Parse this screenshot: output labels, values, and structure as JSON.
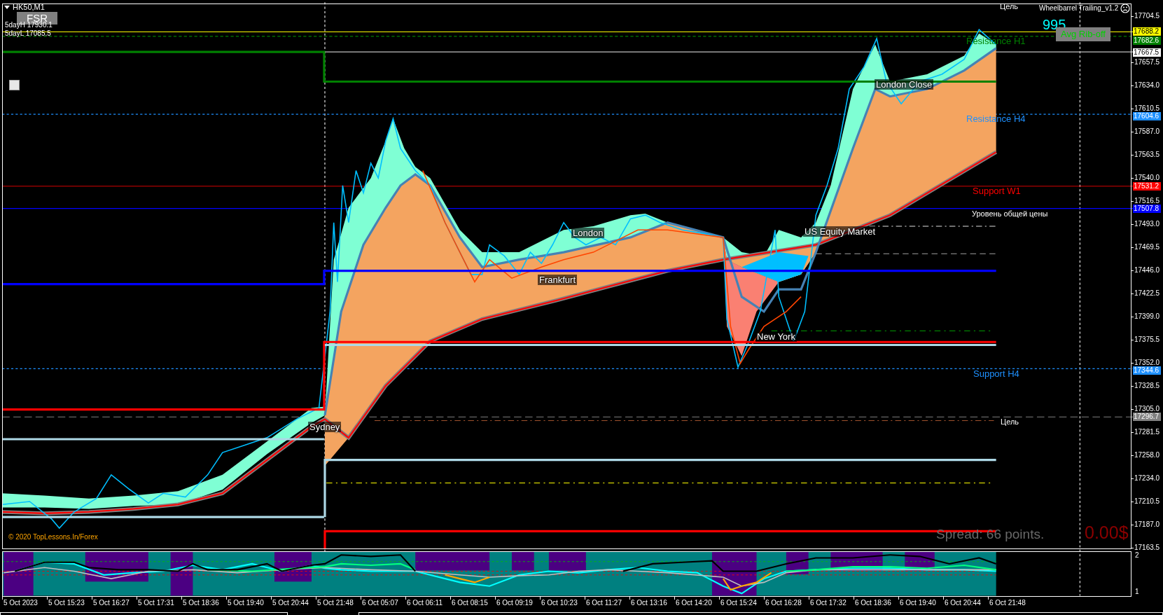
{
  "chart": {
    "symbol": "HK50,M1",
    "fsr_button": "FSR",
    "five_day_high": "5dayH 17930.1",
    "five_day_low": "5dayL 17085.5",
    "expert_name": "Wheelbarrel Trailing_v1.2",
    "counter": "995",
    "avg_button": "Avg Rib-off",
    "copyright": "© 2020 TopLessons.In/Forex",
    "spread": "Spread: 66 points.",
    "profit": "0.00$",
    "level_labels": [
      {
        "text": "Цель",
        "color": "#ffffff"
      },
      {
        "text": "Resistance H1",
        "color": "#008000"
      },
      {
        "text": "Resistance H4",
        "color": "#1e90ff"
      },
      {
        "text": "Support W1",
        "color": "#ff0000"
      },
      {
        "text": "Уровень общей цены",
        "color": "#ffffff"
      },
      {
        "text": "Support H4",
        "color": "#1e90ff"
      },
      {
        "text": "Цель",
        "color": "#ffffff"
      }
    ],
    "session_labels": [
      "Sydney",
      "London",
      "Frankfurt",
      "London Close",
      "US Equity Market",
      "New York"
    ]
  },
  "price_axis": {
    "ticks": [
      "17704.5",
      "17657.5",
      "17634.0",
      "17610.5",
      "17587.0",
      "17563.5",
      "17540.0",
      "17516.5",
      "17493.0",
      "17469.5",
      "17446.0",
      "17422.5",
      "17399.0",
      "17375.5",
      "17352.0",
      "17328.5",
      "17305.0",
      "17281.5",
      "17258.0",
      "17234.0",
      "17210.5",
      "17187.0",
      "17163.5"
    ],
    "markers": [
      {
        "text": "17688.2",
        "color": "#ffff00"
      },
      {
        "text": "17682.6",
        "color": "#008000"
      },
      {
        "text": "17667.5",
        "color": "#ffffff"
      },
      {
        "text": "17604.6",
        "color": "#1e90ff"
      },
      {
        "text": "17531.2",
        "color": "#ff0000"
      },
      {
        "text": "17507.8",
        "color": "#0000ff"
      },
      {
        "text": "17344.6",
        "color": "#1e90ff"
      },
      {
        "text": "17296.7",
        "color": "#808080"
      }
    ]
  },
  "indicator_axis": [
    "2",
    "1"
  ],
  "time_axis": [
    "5 Oct 2023",
    "5 Oct 15:23",
    "5 Oct 16:27",
    "5 Oct 17:31",
    "5 Oct 18:36",
    "5 Oct 19:40",
    "5 Oct 20:44",
    "5 Oct 21:48",
    "6 Oct 05:07",
    "6 Oct 06:11",
    "6 Oct 08:15",
    "6 Oct 09:19",
    "6 Oct 10:23",
    "6 Oct 11:27",
    "6 Oct 13:16",
    "6 Oct 14:20",
    "6 Oct 15:24",
    "6 Oct 16:28",
    "6 Oct 17:32",
    "6 Oct 18:36",
    "6 Oct 19:40",
    "6 Oct 20:44",
    "6 Oct 21:48"
  ]
}
